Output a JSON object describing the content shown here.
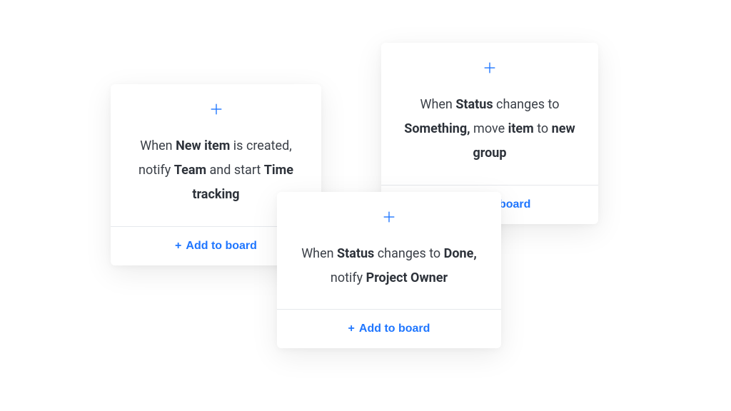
{
  "colors": {
    "accent": "#1f76ff",
    "text": "#3a3f47"
  },
  "cards": [
    {
      "segments": [
        {
          "t": "When ",
          "b": false
        },
        {
          "t": "New item",
          "b": true
        },
        {
          "t": " is created, notify ",
          "b": false
        },
        {
          "t": "Team",
          "b": true
        },
        {
          "t": " and start ",
          "b": false
        },
        {
          "t": "Time tracking",
          "b": true
        }
      ],
      "add_label": "Add to board"
    },
    {
      "segments": [
        {
          "t": "When ",
          "b": false
        },
        {
          "t": "Status",
          "b": true
        },
        {
          "t": " changes to ",
          "b": false
        },
        {
          "t": "Something,",
          "b": true
        },
        {
          "t": " move ",
          "b": false
        },
        {
          "t": "item",
          "b": true
        },
        {
          "t": " to ",
          "b": false
        },
        {
          "t": "new group",
          "b": true
        }
      ],
      "add_label": "Add to board"
    },
    {
      "segments": [
        {
          "t": "When ",
          "b": false
        },
        {
          "t": "Status",
          "b": true
        },
        {
          "t": " changes to ",
          "b": false
        },
        {
          "t": "Done,",
          "b": true
        },
        {
          "t": " notify ",
          "b": false
        },
        {
          "t": "Project Owner",
          "b": true
        }
      ],
      "add_label": "Add to board"
    }
  ]
}
